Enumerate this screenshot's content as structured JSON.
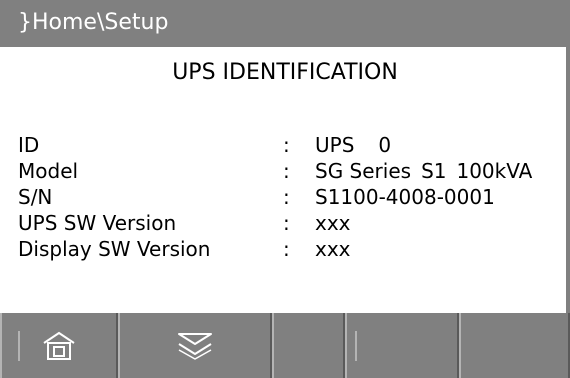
{
  "header": {
    "breadcrumb": "}Home\\Setup"
  },
  "main": {
    "title": "UPS IDENTIFICATION",
    "separator": ":",
    "rows": [
      {
        "label": "ID",
        "value_parts": [
          "UPS",
          "0"
        ]
      },
      {
        "label": "Model",
        "value_parts": [
          "SG Series",
          "S1",
          "100kVA"
        ]
      },
      {
        "label": "S/N",
        "value_parts": [
          "S1100-4008-0001"
        ]
      },
      {
        "label": "UPS SW Version",
        "value_parts": [
          "xxx"
        ]
      },
      {
        "label": "Display SW Version",
        "value_parts": [
          "xxx"
        ]
      }
    ]
  },
  "footer": {
    "keys": [
      {
        "icon": "home-icon"
      },
      {
        "icon": "double-chevron-down-icon"
      },
      {
        "icon": ""
      },
      {
        "icon": ""
      },
      {
        "icon": ""
      }
    ]
  },
  "colors": {
    "bar": "#808080",
    "bar_text": "#ffffff",
    "background": "#ffffff",
    "text": "#000000"
  }
}
